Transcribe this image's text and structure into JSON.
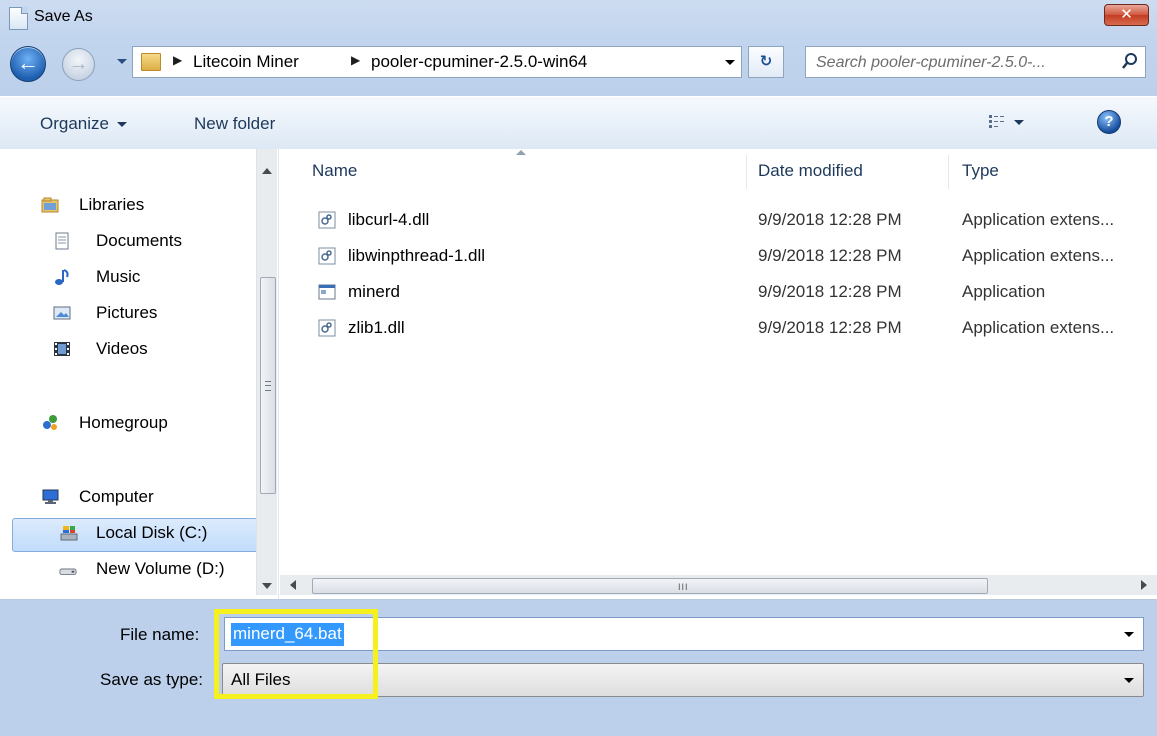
{
  "window": {
    "title": "Save As",
    "close_label": "✕"
  },
  "nav": {
    "back_label": "←",
    "forward_label": "→",
    "breadcrumbs": [
      "Litecoin Miner",
      "pooler-cpuminer-2.5.0-win64"
    ],
    "refresh_label": "↻",
    "search_placeholder": "Search pooler-cpuminer-2.5.0-..."
  },
  "toolbar": {
    "organize_label": "Organize",
    "new_folder_label": "New folder",
    "help_label": "?"
  },
  "sidebar": {
    "items": [
      {
        "label": "Libraries",
        "icon": "libraries-icon"
      },
      {
        "label": "Documents",
        "icon": "documents-icon"
      },
      {
        "label": "Music",
        "icon": "music-icon"
      },
      {
        "label": "Pictures",
        "icon": "pictures-icon"
      },
      {
        "label": "Videos",
        "icon": "videos-icon"
      },
      {
        "label": "Homegroup",
        "icon": "homegroup-icon"
      },
      {
        "label": "Computer",
        "icon": "computer-icon"
      },
      {
        "label": "Local Disk (C:)",
        "icon": "disk-icon",
        "selected": true
      },
      {
        "label": "New Volume (D:)",
        "icon": "drive-icon"
      }
    ]
  },
  "columns": {
    "name": "Name",
    "date": "Date modified",
    "type": "Type"
  },
  "files": [
    {
      "name": "libcurl-4.dll",
      "date": "9/9/2018 12:28 PM",
      "type": "Application extens...",
      "icon": "dll-icon"
    },
    {
      "name": "libwinpthread-1.dll",
      "date": "9/9/2018 12:28 PM",
      "type": "Application extens...",
      "icon": "dll-icon"
    },
    {
      "name": "minerd",
      "date": "9/9/2018 12:28 PM",
      "type": "Application",
      "icon": "application-icon"
    },
    {
      "name": "zlib1.dll",
      "date": "9/9/2018 12:28 PM",
      "type": "Application extens...",
      "icon": "dll-icon"
    }
  ],
  "form": {
    "file_name_label": "File name:",
    "file_name_value": "minerd_64.bat",
    "save_type_label": "Save as type:",
    "save_type_value": "All Files"
  },
  "colors": {
    "highlight": "#f5f01e",
    "selection": "#3399ff",
    "link_text": "#1e395b"
  }
}
